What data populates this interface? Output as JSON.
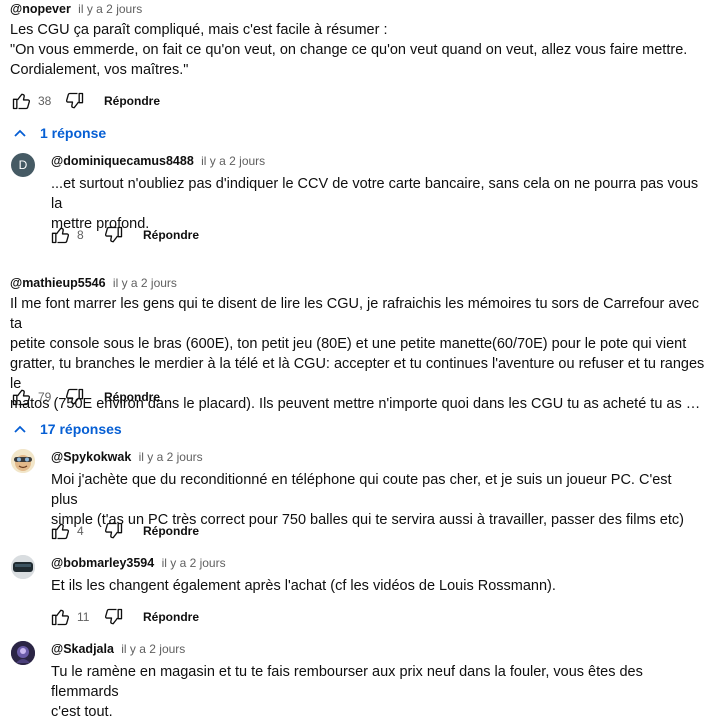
{
  "comments": [
    {
      "author": "@nopever",
      "time": "il y a 2 jours",
      "text": "Les CGU ça paraît compliqué, mais c'est facile à résumer :\n\"On vous emmerde, on fait ce qu'on veut, on change ce qu'on veut quand on veut, allez vous faire mettre.\nCordialement, vos maîtres.\"",
      "likes": "38",
      "reply_label": "Répondre",
      "replies_toggle": "1 réponse",
      "replies": [
        {
          "author": "@dominiquecamus8488",
          "time": "il y a 2 jours",
          "avatar_letter": "D",
          "text": "...et surtout n'oubliez pas d'indiquer le CCV de votre carte bancaire, sans cela on ne pourra pas vous la\nmettre profond.",
          "likes": "8",
          "reply_label": "Répondre"
        }
      ]
    },
    {
      "author": "@mathieup5546",
      "time": "il y a 2 jours",
      "text": "Il me font marrer les gens qui te disent de lire les CGU, je rafraichis les mémoires tu sors de Carrefour avec ta\npetite console sous le bras (600E), ton petit jeu (80E) et une petite manette(60/70E) pour le pote qui vient\ngratter, tu branches le merdier à la télé et là CGU: accepter et tu continues l'aventure ou refuser et tu ranges le\nmatos (750E environ dans le placard). Ils peuvent mettre n'importe quoi dans les CGU tu as acheté tu as …",
      "likes": "79",
      "reply_label": "Répondre",
      "replies_toggle": "17 réponses",
      "replies": [
        {
          "author": "@Spykokwak",
          "time": "il y a 2 jours",
          "text": "Moi j'achète que du reconditionné en téléphone qui coute pas cher, et je suis un joueur PC. C'est plus\nsimple (t'as un PC très correct pour 750 balles qui te servira aussi à travailler, passer des films etc)",
          "likes": "4",
          "reply_label": "Répondre"
        },
        {
          "author": "@bobmarley3594",
          "time": "il y a 2 jours",
          "text": "Et ils les changent également après l'achat (cf les vidéos de Louis Rossmann).",
          "likes": "11",
          "reply_label": "Répondre"
        },
        {
          "author": "@Skadjala",
          "time": "il y a 2 jours",
          "text": "Tu le ramène en magasin et tu te fais rembourser aux prix neuf dans la fouler, vous êtes des flemmards\nc'est tout.",
          "likes": "",
          "reply_label": ""
        }
      ]
    }
  ]
}
